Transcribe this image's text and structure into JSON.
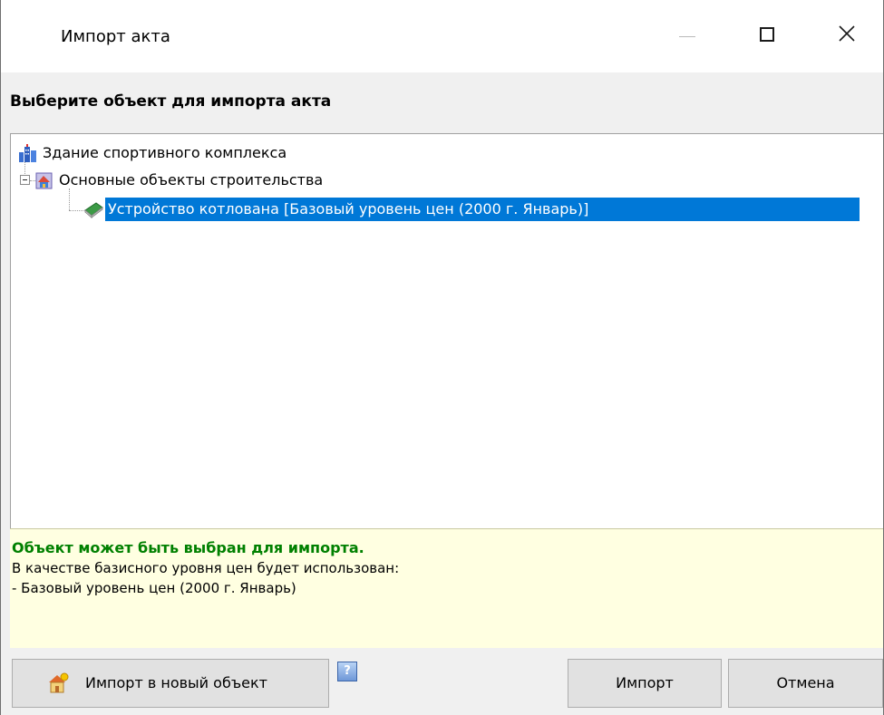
{
  "window": {
    "title": "Импорт акта",
    "controls": [
      "minimize-icon",
      "maximize-icon",
      "close-icon"
    ]
  },
  "heading": "Выберите объект для импорта акта",
  "tree": {
    "items": [
      {
        "label": "Здание спортивного комплекса",
        "icon": "building-icon",
        "level": 0
      },
      {
        "label": "Основные объекты строительства",
        "icon": "construction-object-icon",
        "level": 1,
        "expanded": true
      },
      {
        "label": "Устройство котлована [Базовый уровень цен (2000 г. Январь)]",
        "icon": "book-icon",
        "level": 2,
        "selected": true
      }
    ]
  },
  "info": {
    "status": "Объект может быть выбран для импорта.",
    "line1": "В качестве базисного уровня цен будет использован:",
    "line2": "- Базовый уровень цен (2000 г. Январь)"
  },
  "buttons": {
    "import_new": "Импорт в новый объект",
    "help": "?",
    "import": "Импорт",
    "cancel": "Отмена"
  },
  "colors": {
    "selection": "#0078d7",
    "info_background": "#ffffe1",
    "status_text": "#008000"
  }
}
